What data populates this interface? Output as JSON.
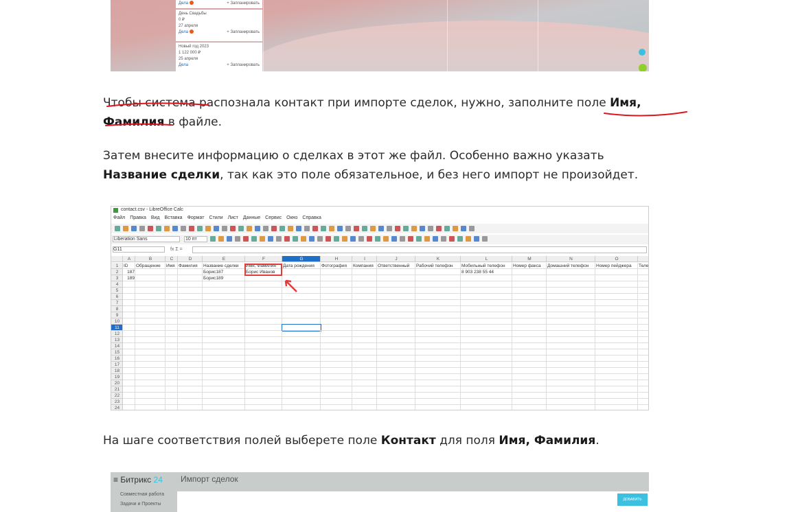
{
  "top_image": {
    "cards": [
      {
        "link": "Дела",
        "badge": "1",
        "action": "+ Запланировать"
      },
      {
        "title": "День Свадьбы",
        "amount": "0 ₽",
        "date": "27 апреля",
        "link": "Дела",
        "badge": "1",
        "action": "+ Запланировать"
      },
      {
        "title": "Новый год 2023",
        "amount": "1 122 000 ₽",
        "date": "25 апреля",
        "link": "Дела",
        "action": "+ Запланировать"
      }
    ]
  },
  "paragraphs": {
    "p1": {
      "t1": "Чтобы система распознала контакт при импорте сделок, нужно, заполните поле ",
      "b1": "Имя,",
      "b2": "Фамилия",
      "t2": " в файле."
    },
    "p2": {
      "t1": "Затем внесите информацию о сделках в этот же файл. Особенно важно указать",
      "b1": "Название сделки",
      "t2": ", так как это поле обязательное, и без него импорт не произойдет."
    },
    "p3": {
      "t1": "На шаге соответствия полей выберете поле ",
      "b1": "Контакт",
      "t2": " для поля ",
      "b2": "Имя, Фамилия",
      "t3": "."
    }
  },
  "spreadsheet": {
    "window_title": "contact.csv - LibreOffice Calc",
    "menu": [
      "Файл",
      "Правка",
      "Вид",
      "Вставка",
      "Формат",
      "Стили",
      "Лист",
      "Данные",
      "Сервис",
      "Окно",
      "Справка"
    ],
    "font_name": "Liberation Sans",
    "font_size": "10 пт",
    "cell_ref": "G11",
    "columns": [
      "A",
      "B",
      "C",
      "D",
      "E",
      "F",
      "G",
      "H",
      "I",
      "J",
      "K",
      "L",
      "M",
      "N",
      "O"
    ],
    "selected_column": "G",
    "selected_row": "11",
    "rows": [
      [
        "ID",
        "Обращение",
        "Имя",
        "Фамилия",
        "Название сделки",
        "Имя, Фамилия",
        "Дата рождения",
        "Фотография",
        "Компания",
        "Ответственный",
        "Рабочий телефон",
        "Мобильный телефон",
        "Номер факса",
        "Домашний телефон",
        "Номер пейджера",
        "Теле"
      ],
      [
        "187",
        "",
        "",
        "",
        "Борис187",
        "Борис Иванов",
        "",
        "",
        "",
        "",
        "",
        "8 903 238 55 44",
        "",
        "",
        "",
        ""
      ],
      [
        "189",
        "",
        "",
        "",
        "Борис189",
        "",
        "",
        "",
        "",
        "",
        "",
        "",
        "",
        "",
        "",
        ""
      ]
    ],
    "row_count": 24,
    "highlight_color": "#e03c3c"
  },
  "bottom_image": {
    "logo": "Битрикс",
    "logo_num": "24",
    "title": "Импорт сделок",
    "menu": [
      "Совместная работа",
      "Задачи и Проекты"
    ],
    "button": "ДОБАВИТЬ"
  },
  "annotation_color": "#e0141e"
}
